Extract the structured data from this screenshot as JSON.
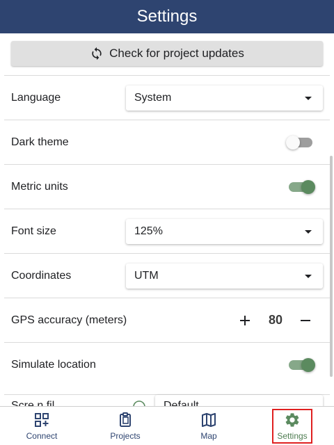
{
  "header": {
    "title": "Settings"
  },
  "update_button": {
    "label": "Check for project updates",
    "icon": "refresh-icon"
  },
  "settings": {
    "language": {
      "label": "Language",
      "value": "System"
    },
    "dark_theme": {
      "label": "Dark theme",
      "enabled": false
    },
    "metric_units": {
      "label": "Metric units",
      "enabled": true
    },
    "font_size": {
      "label": "Font size",
      "value": "125%"
    },
    "coordinates": {
      "label": "Coordinates",
      "value": "UTM"
    },
    "gps_accuracy": {
      "label": "GPS accuracy (meters)",
      "value": "80",
      "plus": "+",
      "minus": "−"
    },
    "simulate_location": {
      "label": "Simulate location",
      "enabled": true
    },
    "partial": {
      "label": "Scre.n fil...",
      "value": "Default"
    }
  },
  "bottom_nav": {
    "items": [
      {
        "label": "Connect",
        "icon": "qr-add-icon"
      },
      {
        "label": "Projects",
        "icon": "clipboard-icon"
      },
      {
        "label": "Map",
        "icon": "map-icon"
      },
      {
        "label": "Settings",
        "icon": "gear-icon",
        "active": true
      }
    ]
  },
  "colors": {
    "header_bg": "#2e4470",
    "accent_green": "#5b8a5f",
    "nav_text": "#2e4470",
    "selection_border": "#e02020"
  }
}
